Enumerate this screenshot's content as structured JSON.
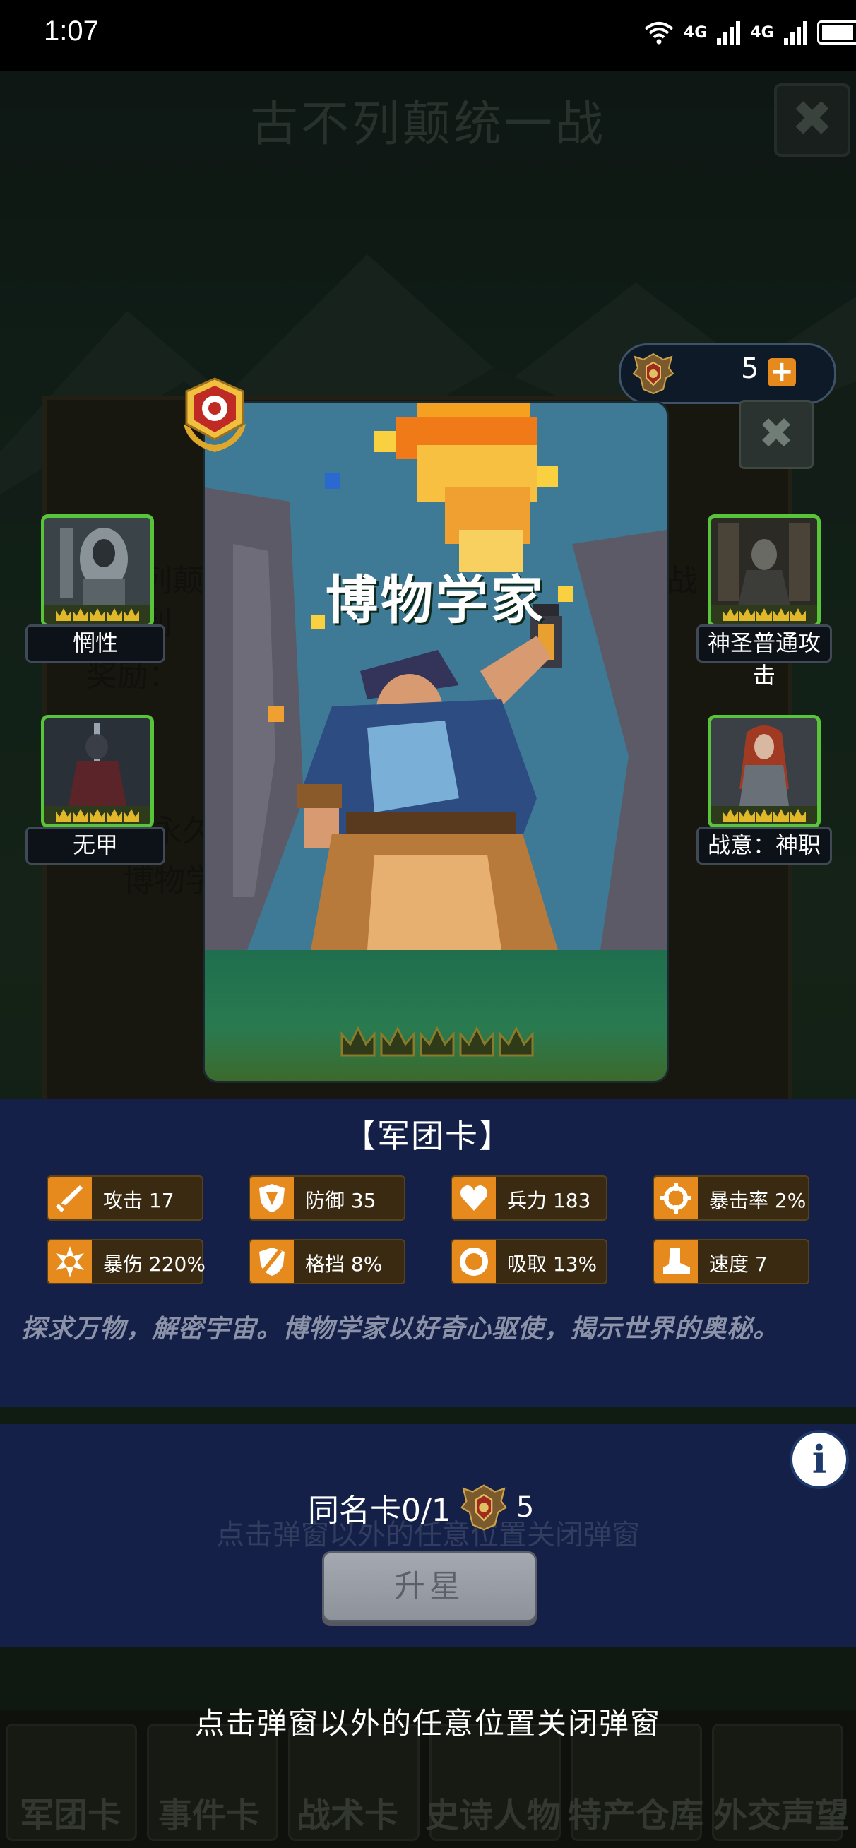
{
  "status_bar": {
    "time": "1:07",
    "network_labels": [
      "4G",
      "4G"
    ]
  },
  "background": {
    "title": "古不列颠统一战",
    "panel_text_1": "列颠",
    "panel_text_2": "利",
    "panel_text_3": "奖励：",
    "panel_text_4": "永久",
    "panel_text_5": "博物学",
    "right_text": "战",
    "tabs": [
      "军团卡",
      "事件卡",
      "战术卡",
      "史诗人物",
      "特产仓库",
      "外交声望"
    ]
  },
  "currency": {
    "count": "5",
    "plus": "+",
    "icon": "winged-crest-icon"
  },
  "card": {
    "name": "博物学家",
    "stars_filled": 0,
    "stars_total": 5,
    "badge_icon": "rank-badge-icon"
  },
  "skills": [
    {
      "label": "惘性",
      "crowns": 5
    },
    {
      "label": "神圣普通攻击",
      "crowns": 5
    },
    {
      "label": "无甲",
      "crowns": 5
    },
    {
      "label": "战意：神职",
      "crowns": 5
    }
  ],
  "card_type": "【军团卡】",
  "stats": [
    {
      "icon": "sword-icon",
      "label": "攻击 17"
    },
    {
      "icon": "shield-icon",
      "label": "防御 35"
    },
    {
      "icon": "heart-icon",
      "label": "兵力 183"
    },
    {
      "icon": "crosshair-icon",
      "label": "暴击率 2%"
    },
    {
      "icon": "burst-icon",
      "label": "暴伤 220%"
    },
    {
      "icon": "block-shield-icon",
      "label": "格挡 8%"
    },
    {
      "icon": "absorb-icon",
      "label": "吸取 13%"
    },
    {
      "icon": "boot-icon",
      "label": "速度 7"
    }
  ],
  "description": "探求万物，解密宇宙。博物学家以好奇心驱使，揭示世界的奥秘。",
  "upgrade": {
    "same_card": "同名卡0/1",
    "cost": "5",
    "button": "升星",
    "info": "i"
  },
  "hint_faint": "点击弹窗以外的任意位置关闭弹窗",
  "close_hint": "点击弹窗以外的任意位置关闭弹窗",
  "colors": {
    "accent_orange": "#e68a1e",
    "panel_navy": "#15204a",
    "skill_border_green": "#58c43a"
  }
}
